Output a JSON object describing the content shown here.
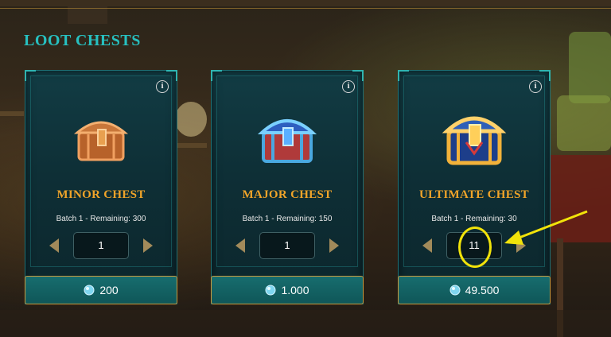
{
  "page": {
    "title": "LOOT CHESTS"
  },
  "chests": [
    {
      "name": "MINOR CHEST",
      "remaining": "Batch 1 - Remaining: 300",
      "quantity": "1",
      "price": "200",
      "tier": "minor"
    },
    {
      "name": "MAJOR CHEST",
      "remaining": "Batch 1 - Remaining: 150",
      "quantity": "1",
      "price": "1.000",
      "tier": "major"
    },
    {
      "name": "ULTIMATE CHEST",
      "remaining": "Batch 1 - Remaining: 30",
      "quantity": "11",
      "price": "49.500",
      "tier": "ultimate"
    }
  ],
  "colors": {
    "title": "#27c0c0",
    "chest_name": "#f0a429",
    "card_border": "#1e6f74",
    "price_bar": "#176d6e",
    "price_border": "#c99a3e",
    "annotation": "#f1e30a"
  },
  "icons": {
    "info": "info-icon",
    "decrement": "chevron-left-icon",
    "increment": "chevron-right-icon",
    "currency": "gem-icon"
  }
}
